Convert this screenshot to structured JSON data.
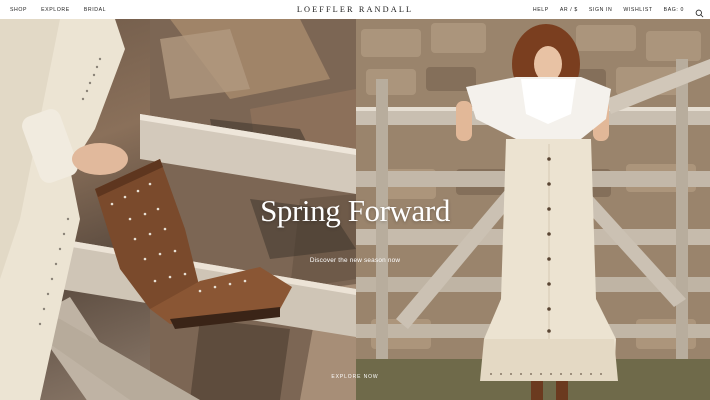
{
  "nav": {
    "left": [
      "SHOP",
      "EXPLORE",
      "BRIDAL"
    ],
    "logo": "LOEFFLER RANDALL",
    "right": [
      "HELP",
      "AR / $",
      "SIGN IN",
      "WISHLIST",
      "BAG: 0"
    ],
    "search_icon": "search-icon"
  },
  "hero": {
    "title": "Spring Forward",
    "subtitle": "Discover the new season now",
    "cta": "EXPLORE NOW",
    "scroll_icon": "chevron-down-icon"
  },
  "colors": {
    "text": "#1d1d1d",
    "hero_text": "#ffffff",
    "stone": "#9c8670",
    "boot": "#7a4a2c",
    "dress": "#ece4d3"
  }
}
